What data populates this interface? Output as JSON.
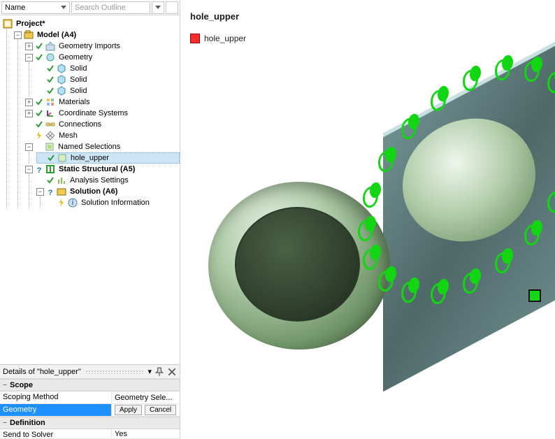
{
  "filter": {
    "name_label": "Name",
    "search_placeholder": "Search Outline"
  },
  "tree": {
    "project": "Project*",
    "model": "Model (A4)",
    "geom_imports": "Geometry Imports",
    "geometry": "Geometry",
    "solid": "Solid",
    "materials": "Materials",
    "coord": "Coordinate Systems",
    "connections": "Connections",
    "mesh": "Mesh",
    "named_sel": "Named Selections",
    "hole_upper": "hole_upper",
    "static": "Static Structural (A5)",
    "analysis": "Analysis Settings",
    "solution": "Solution (A6)",
    "sol_info": "Solution Information"
  },
  "details": {
    "title": "Details of \"hole_upper\"",
    "scope": "Scope",
    "scoping_method": "Scoping Method",
    "scoping_method_val": "Geometry Sele...",
    "geometry": "Geometry",
    "apply": "Apply",
    "cancel": "Cancel",
    "definition": "Definition",
    "send_solver": "Send to Solver",
    "send_solver_val": "Yes"
  },
  "viewport": {
    "title": "hole_upper",
    "legend_label": "hole_upper"
  }
}
